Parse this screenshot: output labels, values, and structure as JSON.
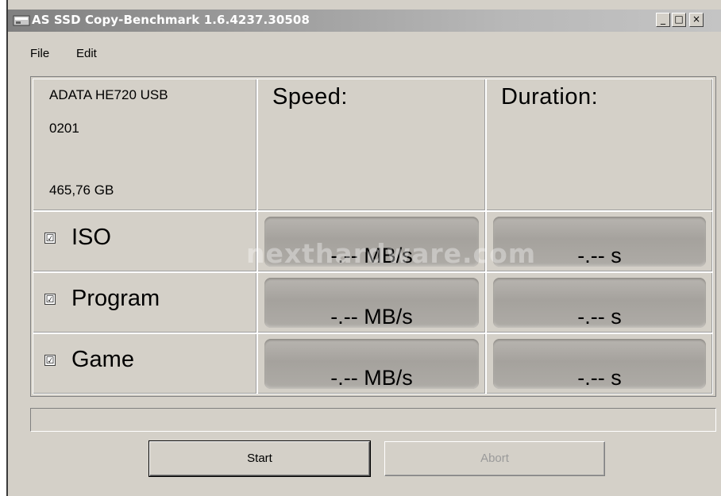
{
  "window": {
    "title": "AS SSD Copy-Benchmark 1.6.4237.30508",
    "controls": [
      "_",
      "□",
      "×"
    ]
  },
  "menu": [
    "File",
    "Edit"
  ],
  "drive": {
    "name": "ADATA HE720 USB",
    "firmware": "0201",
    "capacity": "465,76 GB"
  },
  "headers": {
    "speed": "Speed:",
    "duration": "Duration:"
  },
  "rows": [
    {
      "label": "ISO",
      "checked": true,
      "speed": "-.-- MB/s",
      "duration": "-.-- s"
    },
    {
      "label": "Program",
      "checked": true,
      "speed": "-.-- MB/s",
      "duration": "-.-- s"
    },
    {
      "label": "Game",
      "checked": true,
      "speed": "-.-- MB/s",
      "duration": "-.-- s"
    }
  ],
  "checkmark": "☑",
  "watermark": "nexthardware.com",
  "buttons": {
    "start": "Start",
    "abort": "Abort"
  },
  "progress": 0
}
